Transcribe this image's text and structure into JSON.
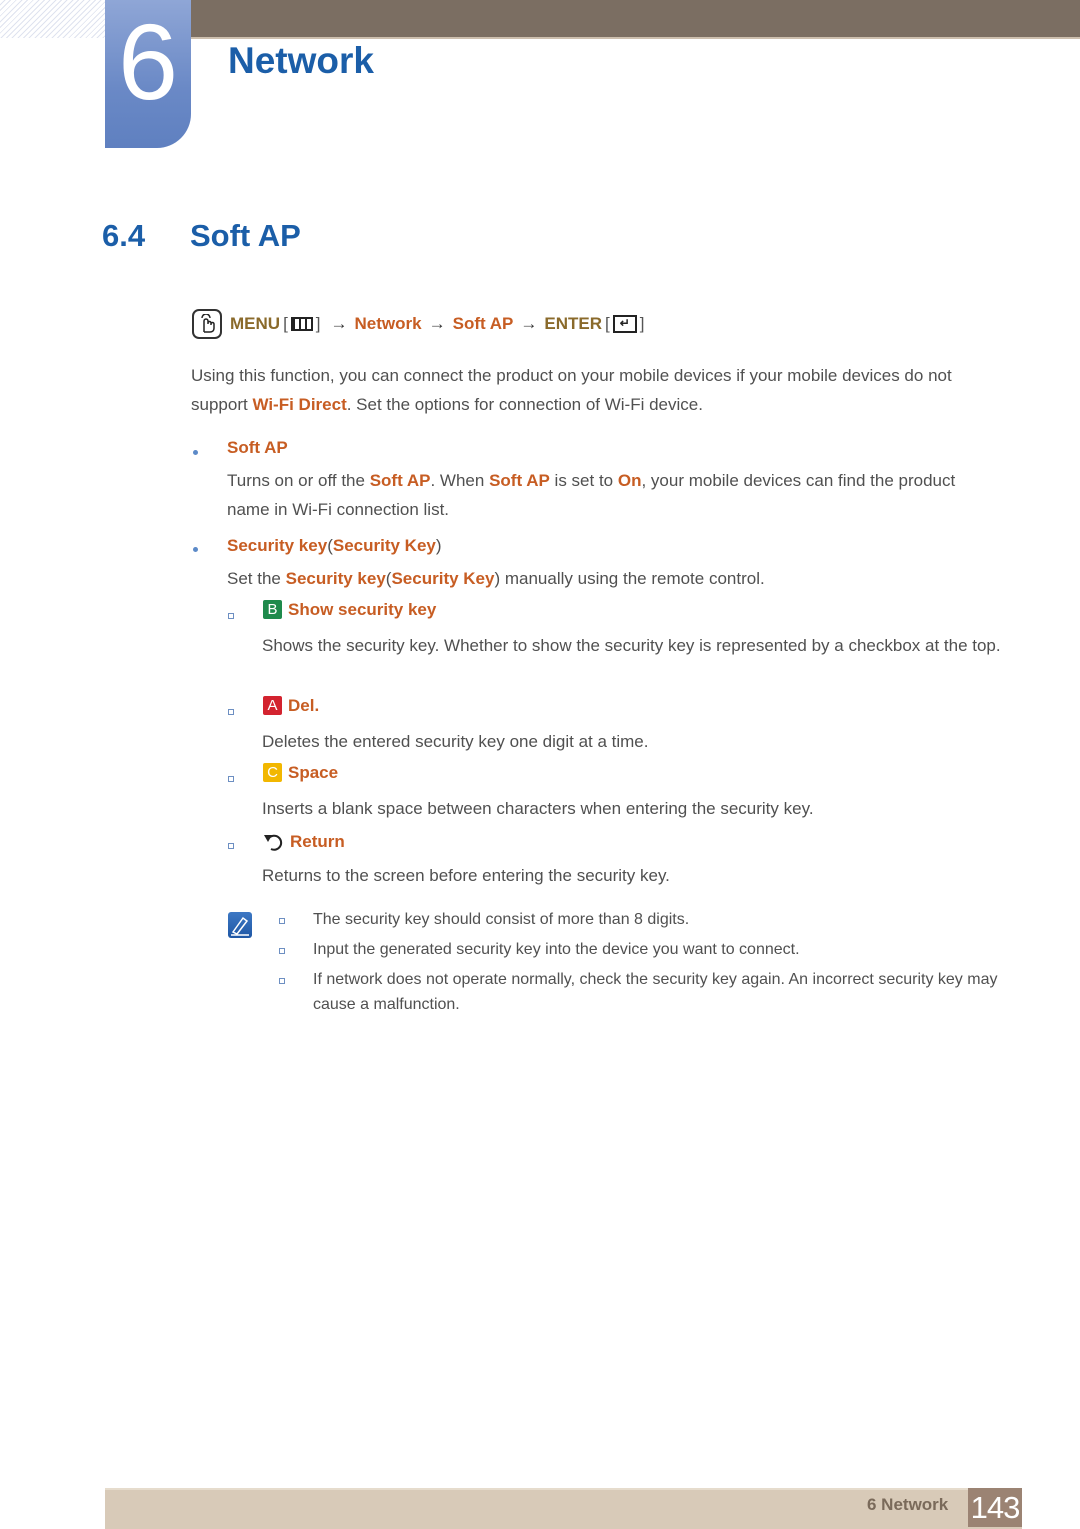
{
  "header": {
    "chapter_number": "6",
    "chapter_title": "Network"
  },
  "section": {
    "number": "6.4",
    "title": "Soft AP"
  },
  "menu_path": {
    "menu_label": "MENU",
    "network": "Network",
    "soft_ap": "Soft AP",
    "enter_label": "ENTER",
    "arrow": "→",
    "open_bracket": "[",
    "close_bracket": "]"
  },
  "intro": {
    "text_1": "Using this function, you can connect the product on your mobile devices if your mobile devices do not support ",
    "highlight": "Wi-Fi Direct",
    "text_2": ". Set the options for connection of Wi-Fi device."
  },
  "items": {
    "soft_ap": {
      "title": "Soft AP",
      "desc_1": "Turns on or off the ",
      "hl_1": "Soft AP",
      "desc_2": ". When ",
      "hl_2": "Soft AP",
      "desc_3": " is set to ",
      "hl_3": "On",
      "desc_4": ", your mobile devices can find the product name in Wi-Fi connection list."
    },
    "security_key": {
      "title_a": "Security key",
      "title_paren_open": "(",
      "title_b": "Security Key",
      "title_paren_close": ")",
      "desc_1": "Set the ",
      "hl_1": "Security key",
      "desc_2": "(",
      "hl_2": "Security Key",
      "desc_3": ") manually using the remote control."
    }
  },
  "sub_items": [
    {
      "key": "B",
      "key_color": "#1e8a4c",
      "title": "Show security key",
      "desc": "Shows the security key. Whether to show the security key is represented by a checkbox at the top."
    },
    {
      "key": "A",
      "key_color": "#d3232f",
      "title": "Del.",
      "desc": "Deletes the entered security key one digit at a time."
    },
    {
      "key": "C",
      "key_color": "#f2b700",
      "title": "Space",
      "desc": "Inserts a blank space between characters when entering the security key."
    },
    {
      "key": "return-icon",
      "title": "Return",
      "desc": "Returns to the screen before entering the security key."
    }
  ],
  "notes": [
    "The security key should consist of more than 8 digits.",
    "Input the generated security key into the device you want to connect.",
    "If network does not operate normally, check the security key again. An incorrect security key may cause a malfunction."
  ],
  "footer": {
    "label": "6 Network",
    "page_number": "143"
  },
  "colors": {
    "heading_blue": "#1b5ea8",
    "highlight_orange": "#c75d23",
    "top_bar": "#7b6e62",
    "footer_bar": "#d8cab8",
    "page_box": "#9b8373"
  }
}
